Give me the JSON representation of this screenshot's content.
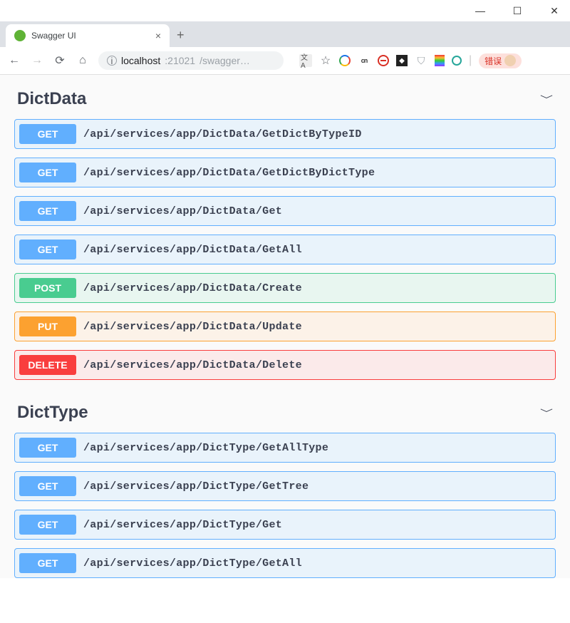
{
  "window": {
    "minimize": "—",
    "maximize": "☐",
    "close": "✕"
  },
  "tab": {
    "title": "Swagger UI",
    "close": "×",
    "new_tab": "+"
  },
  "address": {
    "host": "localhost",
    "port": ":21021",
    "path": "/swagger…"
  },
  "chrome": {
    "translate_label": "文A",
    "dark_sq": "◆",
    "shield": "⛉",
    "error_label": "错误"
  },
  "sections": [
    {
      "name": "DictData",
      "ops": [
        {
          "method": "GET",
          "cls": "get",
          "path": "/api/services/app/DictData/GetDictByTypeID"
        },
        {
          "method": "GET",
          "cls": "get",
          "path": "/api/services/app/DictData/GetDictByDictType"
        },
        {
          "method": "GET",
          "cls": "get",
          "path": "/api/services/app/DictData/Get"
        },
        {
          "method": "GET",
          "cls": "get",
          "path": "/api/services/app/DictData/GetAll"
        },
        {
          "method": "POST",
          "cls": "post",
          "path": "/api/services/app/DictData/Create"
        },
        {
          "method": "PUT",
          "cls": "put",
          "path": "/api/services/app/DictData/Update"
        },
        {
          "method": "DELETE",
          "cls": "delete",
          "path": "/api/services/app/DictData/Delete"
        }
      ]
    },
    {
      "name": "DictType",
      "ops": [
        {
          "method": "GET",
          "cls": "get",
          "path": "/api/services/app/DictType/GetAllType"
        },
        {
          "method": "GET",
          "cls": "get",
          "path": "/api/services/app/DictType/GetTree"
        },
        {
          "method": "GET",
          "cls": "get",
          "path": "/api/services/app/DictType/Get"
        },
        {
          "method": "GET",
          "cls": "get",
          "path": "/api/services/app/DictType/GetAll"
        }
      ]
    }
  ]
}
